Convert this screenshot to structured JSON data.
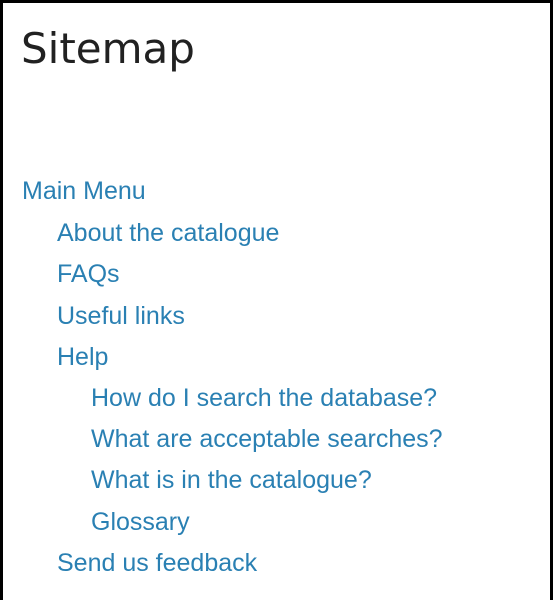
{
  "page": {
    "title": "Sitemap"
  },
  "sitemap": {
    "main_menu": "Main Menu",
    "about": "About the catalogue",
    "faqs": "FAQs",
    "useful_links": "Useful links",
    "help": "Help",
    "help_search": "How do I search the database?",
    "help_acceptable": "What are acceptable searches?",
    "help_contents": "What is in the catalogue?",
    "help_glossary": "Glossary",
    "feedback": "Send us feedback"
  },
  "colors": {
    "link": "#2a80b3",
    "title": "#212121",
    "border": "#000000",
    "background": "#ffffff"
  }
}
